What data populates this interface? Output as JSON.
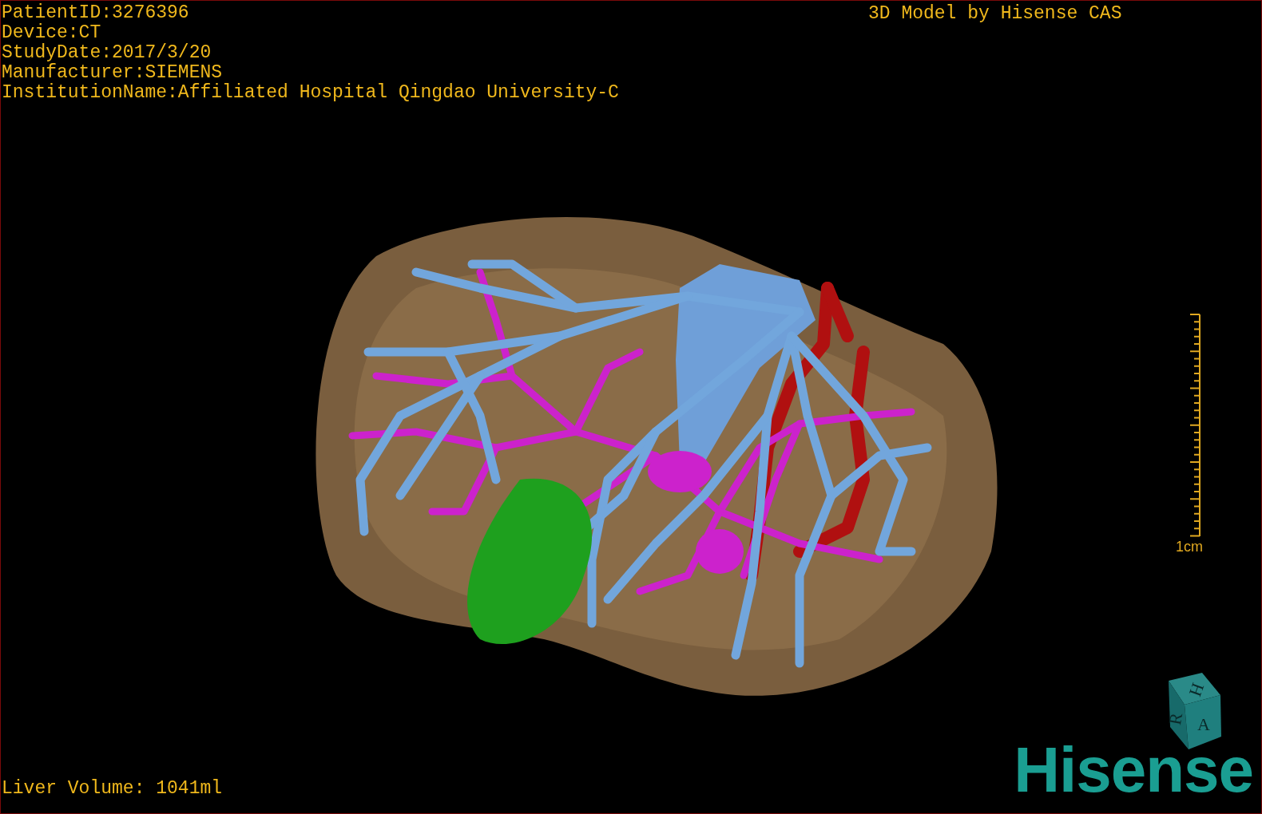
{
  "info_lines": [
    "PatientID:3276396",
    "Device:CT",
    "StudyDate:2017/3/20",
    "Manufacturer:SIEMENS",
    "InstitutionName:Affiliated Hospital Qingdao University-C"
  ],
  "title": "3D Model by Hisense CAS",
  "scale_bar": {
    "label": "1cm"
  },
  "orientation_cube": {
    "faces": [
      "H",
      "R",
      "A"
    ]
  },
  "logo": "Hisense",
  "liver_volume": "Liver Volume: 1041ml"
}
